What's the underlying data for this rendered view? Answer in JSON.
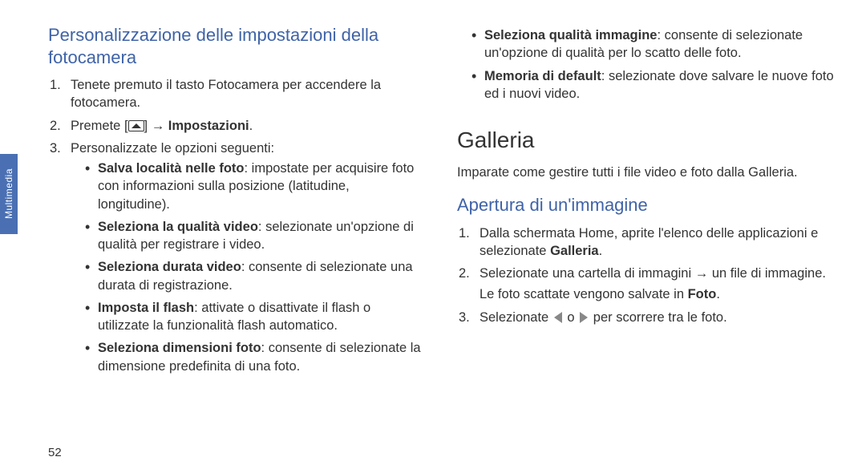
{
  "sideTab": "Multimedia",
  "pageNumber": "52",
  "col1": {
    "heading": "Personalizzazione delle impostazioni della fotocamera",
    "steps": {
      "s1_num": "1.",
      "s1": "Tenete premuto il tasto Fotocamera per accendere la fotocamera.",
      "s2_num": "2.",
      "s2_pre": "Premete [",
      "s2_post": "] → ",
      "s2_bold": "Impostazioni",
      "s2_end": ".",
      "s3_num": "3.",
      "s3": "Personalizzate le opzioni seguenti:"
    },
    "bullets": {
      "b1_bold": "Salva località nelle foto",
      "b1_rest": ": impostate per acquisire foto con informazioni sulla posizione (latitudine, longitudine).",
      "b2_bold": "Seleziona la qualità video",
      "b2_rest": ": selezionate un'opzione di qualità per registrare i video.",
      "b3_bold": "Seleziona durata video",
      "b3_rest": ": consente di selezionate una durata di registrazione.",
      "b4_bold": "Imposta il flash",
      "b4_rest": ": attivate o disattivate il flash o utilizzate la funzionalità flash automatico.",
      "b5_bold": "Seleziona dimensioni foto",
      "b5_rest": ": consente di selezionate la dimensione predefinita di una foto."
    }
  },
  "col2": {
    "topBullets": {
      "b1_bold": "Seleziona qualità immagine",
      "b1_rest": ": consente di selezionate un'opzione di qualità per lo scatto delle foto.",
      "b2_bold": "Memoria di default",
      "b2_rest": ": selezionate dove salvare le nuove foto ed i nuovi video."
    },
    "galleriaTitle": "Galleria",
    "galleriaIntro": "Imparate come gestire tutti i file video e foto dalla Galleria.",
    "subHeading": "Apertura di un'immagine",
    "steps": {
      "s1_num": "1.",
      "s1_pre": "Dalla schermata Home, aprite l'elenco delle applicazioni e selezionate ",
      "s1_bold": "Galleria",
      "s1_end": ".",
      "s2_num": "2.",
      "s2": "Selezionate una cartella di immagini → un file di immagine.",
      "s2_sub_pre": "Le foto scattate vengono salvate in ",
      "s2_sub_bold": "Foto",
      "s2_sub_end": ".",
      "s3_num": "3.",
      "s3_pre": "Selezionate ",
      "s3_mid": " o ",
      "s3_post": " per scorrere tra le foto."
    }
  }
}
